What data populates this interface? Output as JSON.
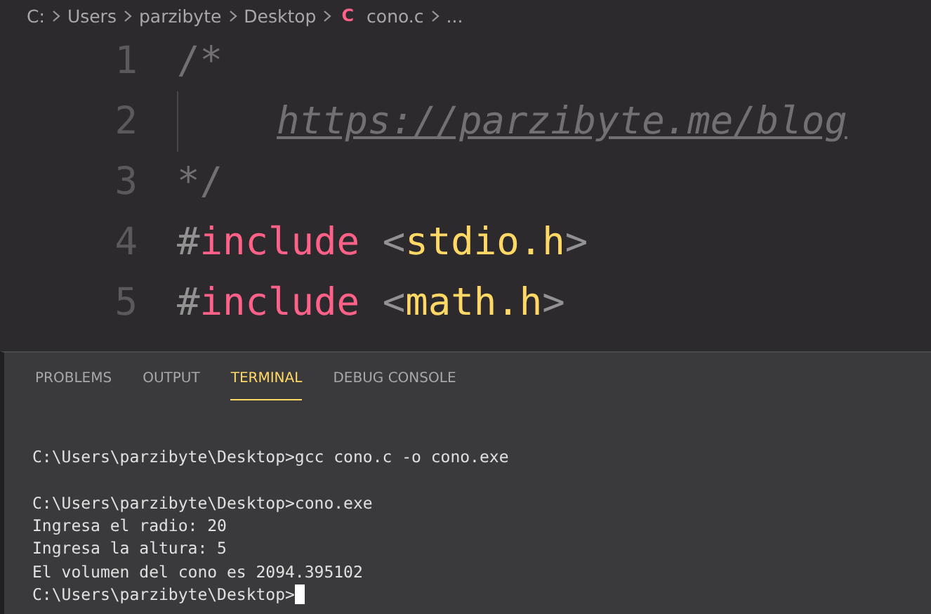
{
  "breadcrumb": [
    {
      "kind": "text",
      "text": "C:"
    },
    {
      "kind": "text",
      "text": "Users"
    },
    {
      "kind": "text",
      "text": "parzibyte"
    },
    {
      "kind": "text",
      "text": "Desktop"
    },
    {
      "kind": "file",
      "icon": "C",
      "text": "cono.c"
    },
    {
      "kind": "text",
      "text": "..."
    }
  ],
  "editor": {
    "lines": [
      {
        "number": "1",
        "tokens": [
          {
            "kind": "comment",
            "text": "/*"
          }
        ]
      },
      {
        "number": "2",
        "indent": true,
        "tokens": [
          {
            "kind": "url",
            "text": "https://parzibyte.me/blog"
          }
        ]
      },
      {
        "number": "3",
        "tokens": [
          {
            "kind": "comment",
            "text": "*/"
          }
        ]
      },
      {
        "number": "4",
        "tokens": [
          {
            "kind": "plain",
            "text": "#"
          },
          {
            "kind": "keyword",
            "text": "include"
          },
          {
            "kind": "plain",
            "text": " <"
          },
          {
            "kind": "string",
            "text": "stdio.h"
          },
          {
            "kind": "plain",
            "text": ">"
          }
        ]
      },
      {
        "number": "5",
        "tokens": [
          {
            "kind": "plain",
            "text": "#"
          },
          {
            "kind": "keyword",
            "text": "include"
          },
          {
            "kind": "plain",
            "text": " <"
          },
          {
            "kind": "string",
            "text": "math.h"
          },
          {
            "kind": "plain",
            "text": ">"
          }
        ]
      }
    ]
  },
  "panel": {
    "tabs": [
      {
        "label": "PROBLEMS",
        "selected": false
      },
      {
        "label": "OUTPUT",
        "selected": false
      },
      {
        "label": "TERMINAL",
        "selected": true
      },
      {
        "label": "DEBUG CONSOLE",
        "selected": false
      }
    ],
    "terminal": {
      "cursor": true,
      "lines": [
        [
          "C:\\Users\\parzibyte\\Desktop>gcc cono.c -o cono.exe"
        ],
        [
          "C:\\Users\\parzibyte\\Desktop>cono.exe",
          "Ingresa el radio: 20",
          "Ingresa la altura: 5",
          "El volumen del cono es 2094.395102",
          "C:\\Users\\parzibyte\\Desktop>"
        ]
      ]
    }
  }
}
